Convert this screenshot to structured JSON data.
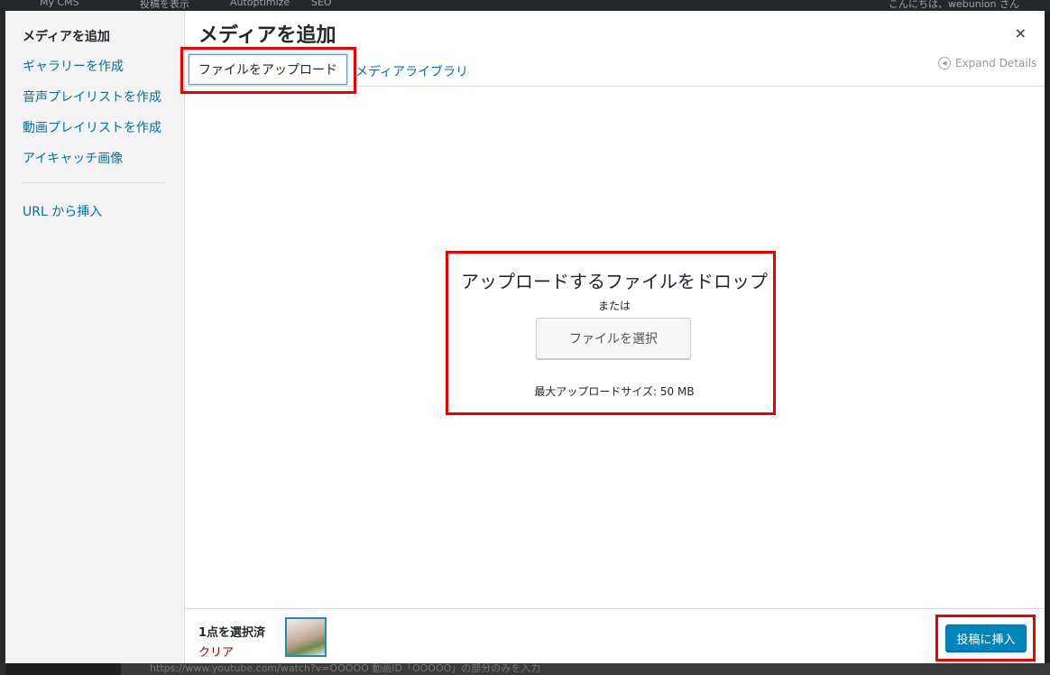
{
  "admin_bar": {
    "site_name": "My CMS",
    "view_post": "投稿を表示",
    "autoptimize": "Autoptimize",
    "seo": "SEO",
    "greeting": "こんにちは、webunion さん"
  },
  "modal": {
    "title": "メディアを追加",
    "close_label": "×"
  },
  "sidebar": {
    "items": [
      {
        "label": "メディアを追加"
      },
      {
        "label": "ギャラリーを作成"
      },
      {
        "label": "音声プレイリストを作成"
      },
      {
        "label": "動画プレイリストを作成"
      },
      {
        "label": "アイキャッチ画像"
      },
      {
        "label": "URL から挿入"
      }
    ]
  },
  "tabs": {
    "upload": "ファイルをアップロード",
    "library": "メディアライブラリ"
  },
  "expand_details": "Expand Details",
  "uploader": {
    "drop_text": "アップロードするファイルをドロップ",
    "or_text": "または",
    "select_button": "ファイルを選択",
    "max_size": "最大アップロードサイズ: 50 MB"
  },
  "toolbar": {
    "selection_count": "1点を選択済",
    "clear": "クリア",
    "insert_button": "投稿に挿入"
  },
  "background_text": "https://www.youtube.com/watch?v=OOOOO 動画ID「OOOOO」の部分のみを入力",
  "colors": {
    "accent": "#0085ba",
    "link": "#0073aa",
    "highlight": "#e00000",
    "clear_link": "#aa0000"
  }
}
